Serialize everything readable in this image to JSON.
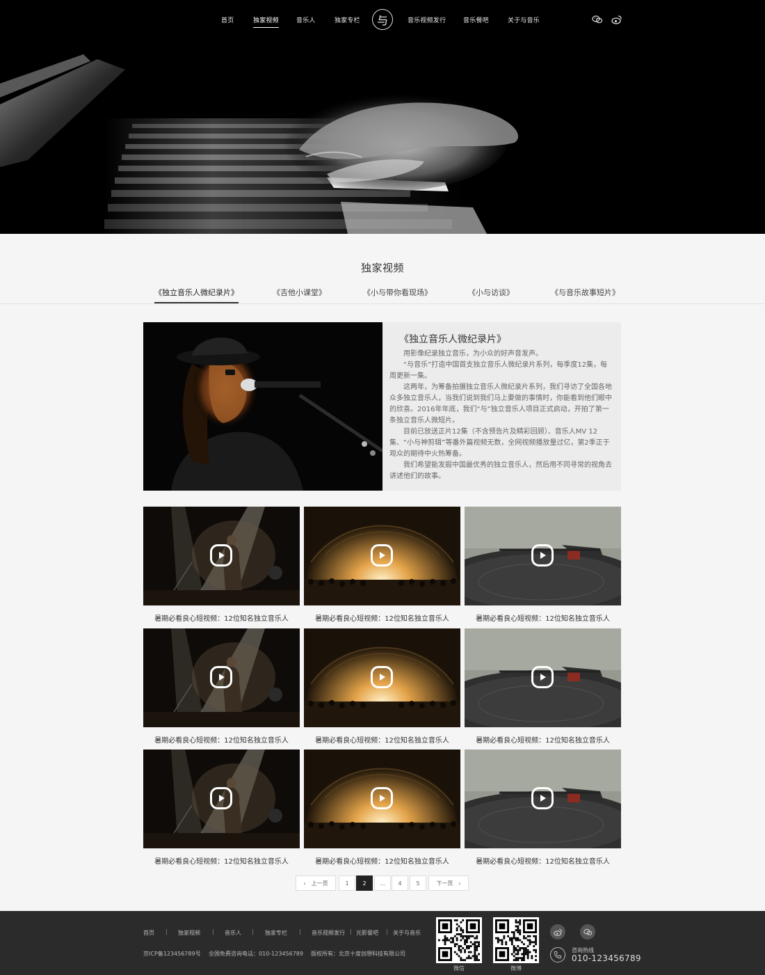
{
  "nav": {
    "home": "首页",
    "exclusive_video": "独家视频",
    "musicians": "音乐人",
    "columns": "独家专栏",
    "logo_char": "与",
    "video_release": "音乐视频发行",
    "bar": "音乐餐吧",
    "about": "关于与音乐"
  },
  "section": {
    "title": "独家视频",
    "tabs": [
      "《独立音乐人微纪录片》",
      "《吉他小课堂》",
      "《小与带你看现场》",
      "《小与访谈》",
      "《与音乐故事短片》"
    ]
  },
  "feature": {
    "title": "《独立音乐人微纪录片》",
    "paragraphs": [
      "用影像纪录独立音乐，为小众的好声音发声。",
      "“与音乐”打造中国首支独立音乐人微纪录片系列，每季度12集，每周更新一集。",
      "这两年，为筹备拍摄独立音乐人微纪录片系列，我们寻访了全国各地众多独立音乐人，当我们说到我们马上要做的事情时，你能看到他们眼中的欣喜。2016年年底，我们“与”独立音乐人项目正式启动，开拍了第一条独立音乐人微短片。",
      "目前已放送正片12集（不含预告片及精彩回顾）、音乐人MV 12集、“小与神剪辑”等番外篇视频无数，全网视频播放量过亿，第2季正于观众的期待中火热筹备。",
      "我们希望能发掘中国最优秀的独立音乐人，然后用不同寻常的视角去讲述他们的故事。"
    ]
  },
  "videos": [
    {
      "caption": "暑期必看良心短视频：12位知名独立音乐人",
      "scene": "concert"
    },
    {
      "caption": "暑期必看良心短视频：12位知名独立音乐人",
      "scene": "arena"
    },
    {
      "caption": "暑期必看良心短视频：12位知名独立音乐人",
      "scene": "turntable"
    },
    {
      "caption": "暑期必看良心短视频：12位知名独立音乐人",
      "scene": "concert"
    },
    {
      "caption": "暑期必看良心短视频：12位知名独立音乐人",
      "scene": "arena"
    },
    {
      "caption": "暑期必看良心短视频：12位知名独立音乐人",
      "scene": "turntable"
    },
    {
      "caption": "暑期必看良心短视频：12位知名独立音乐人",
      "scene": "concert"
    },
    {
      "caption": "暑期必看良心短视频：12位知名独立音乐人",
      "scene": "arena"
    },
    {
      "caption": "暑期必看良心短视频：12位知名独立音乐人",
      "scene": "turntable"
    }
  ],
  "pagination": {
    "prev": "上一页",
    "pages": [
      "1",
      "2",
      "...",
      "4",
      "5"
    ],
    "current": "2",
    "next": "下一页"
  },
  "footer": {
    "links": [
      "首页",
      "独家视频",
      "音乐人",
      "独家专栏",
      "音乐视频发行",
      "光影餐吧",
      "关于与音乐"
    ],
    "separator": "|",
    "icp": "京ICP备123456789号",
    "phone_line": "全国免费咨询电话：010-123456789",
    "copyright": "版权所有：北京十度创想科技有限公司",
    "qr": [
      {
        "label": "微信"
      },
      {
        "label": "微博"
      }
    ],
    "hotline_label": "咨询热线",
    "hotline_number": "010-123456789"
  },
  "icons": {
    "wechat": "wechat-icon",
    "weibo": "weibo-icon",
    "phone": "phone-icon",
    "play": "play-icon"
  },
  "colors": {
    "footer_bg": "#2b2b2b",
    "active_page": "#222222",
    "hero_bg": "#000000"
  }
}
